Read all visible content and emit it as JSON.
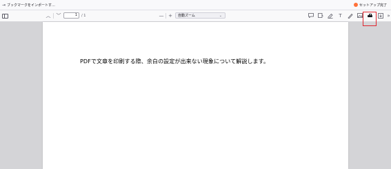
{
  "bookmarks_bar": {
    "import_label": "ブックマークをインポートす...",
    "setup_label": "セットアップ完了"
  },
  "toolbar": {
    "page_current": "1",
    "page_total": "/ 1",
    "zoom_out_label": "—",
    "zoom_in_label": "+",
    "zoom_value": "自動ズーム",
    "zoom_chevron": "⌄",
    "tools": [
      "comment-icon",
      "stamp-icon",
      "highlight-pen-icon",
      "text-icon",
      "ink-icon",
      "image-icon",
      "print-icon",
      "save-icon",
      "more-tools-icon"
    ],
    "highlight_color": "#e0242d"
  },
  "document": {
    "text": "PDFで文章を印刷する際、余白の設定が出来ない現象について解説します。"
  }
}
